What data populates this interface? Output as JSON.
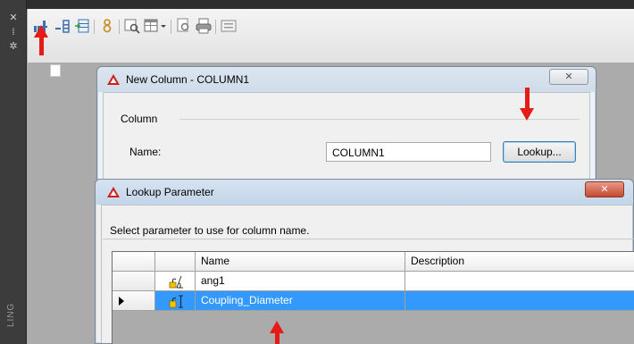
{
  "side_palette": {
    "glyphs": [
      "✕",
      "⁞",
      "✲"
    ],
    "label": "LING"
  },
  "toolbar": {
    "tools": [
      "insert-column-icon",
      "insert-row-icon",
      "table-import-icon",
      "attribute-icon",
      "preview-icon",
      "table-style-icon",
      "dropdown-icon",
      "find-icon",
      "print-icon",
      "export-icon"
    ]
  },
  "new_column_dialog": {
    "title": "New Column - COLUMN1",
    "close_glyph": "✕",
    "group_caption": "Column",
    "name_label": "Name:",
    "name_value": "COLUMN1",
    "lookup_button": "Lookup..."
  },
  "lookup_dialog": {
    "title": "Lookup Parameter",
    "close_glyph": "✕",
    "instruction": "Select parameter to use for column name.",
    "columns": [
      "Name",
      "Description"
    ],
    "rows": [
      {
        "name": "ang1",
        "description": "",
        "icon": "angular-param-icon",
        "selected": false
      },
      {
        "name": "Coupling_Diameter",
        "description": "",
        "icon": "linear-param-icon",
        "selected": true
      }
    ]
  },
  "colors": {
    "arrow": "#e41b17",
    "selection": "#3399ff",
    "close_hot": "#c44a30"
  }
}
